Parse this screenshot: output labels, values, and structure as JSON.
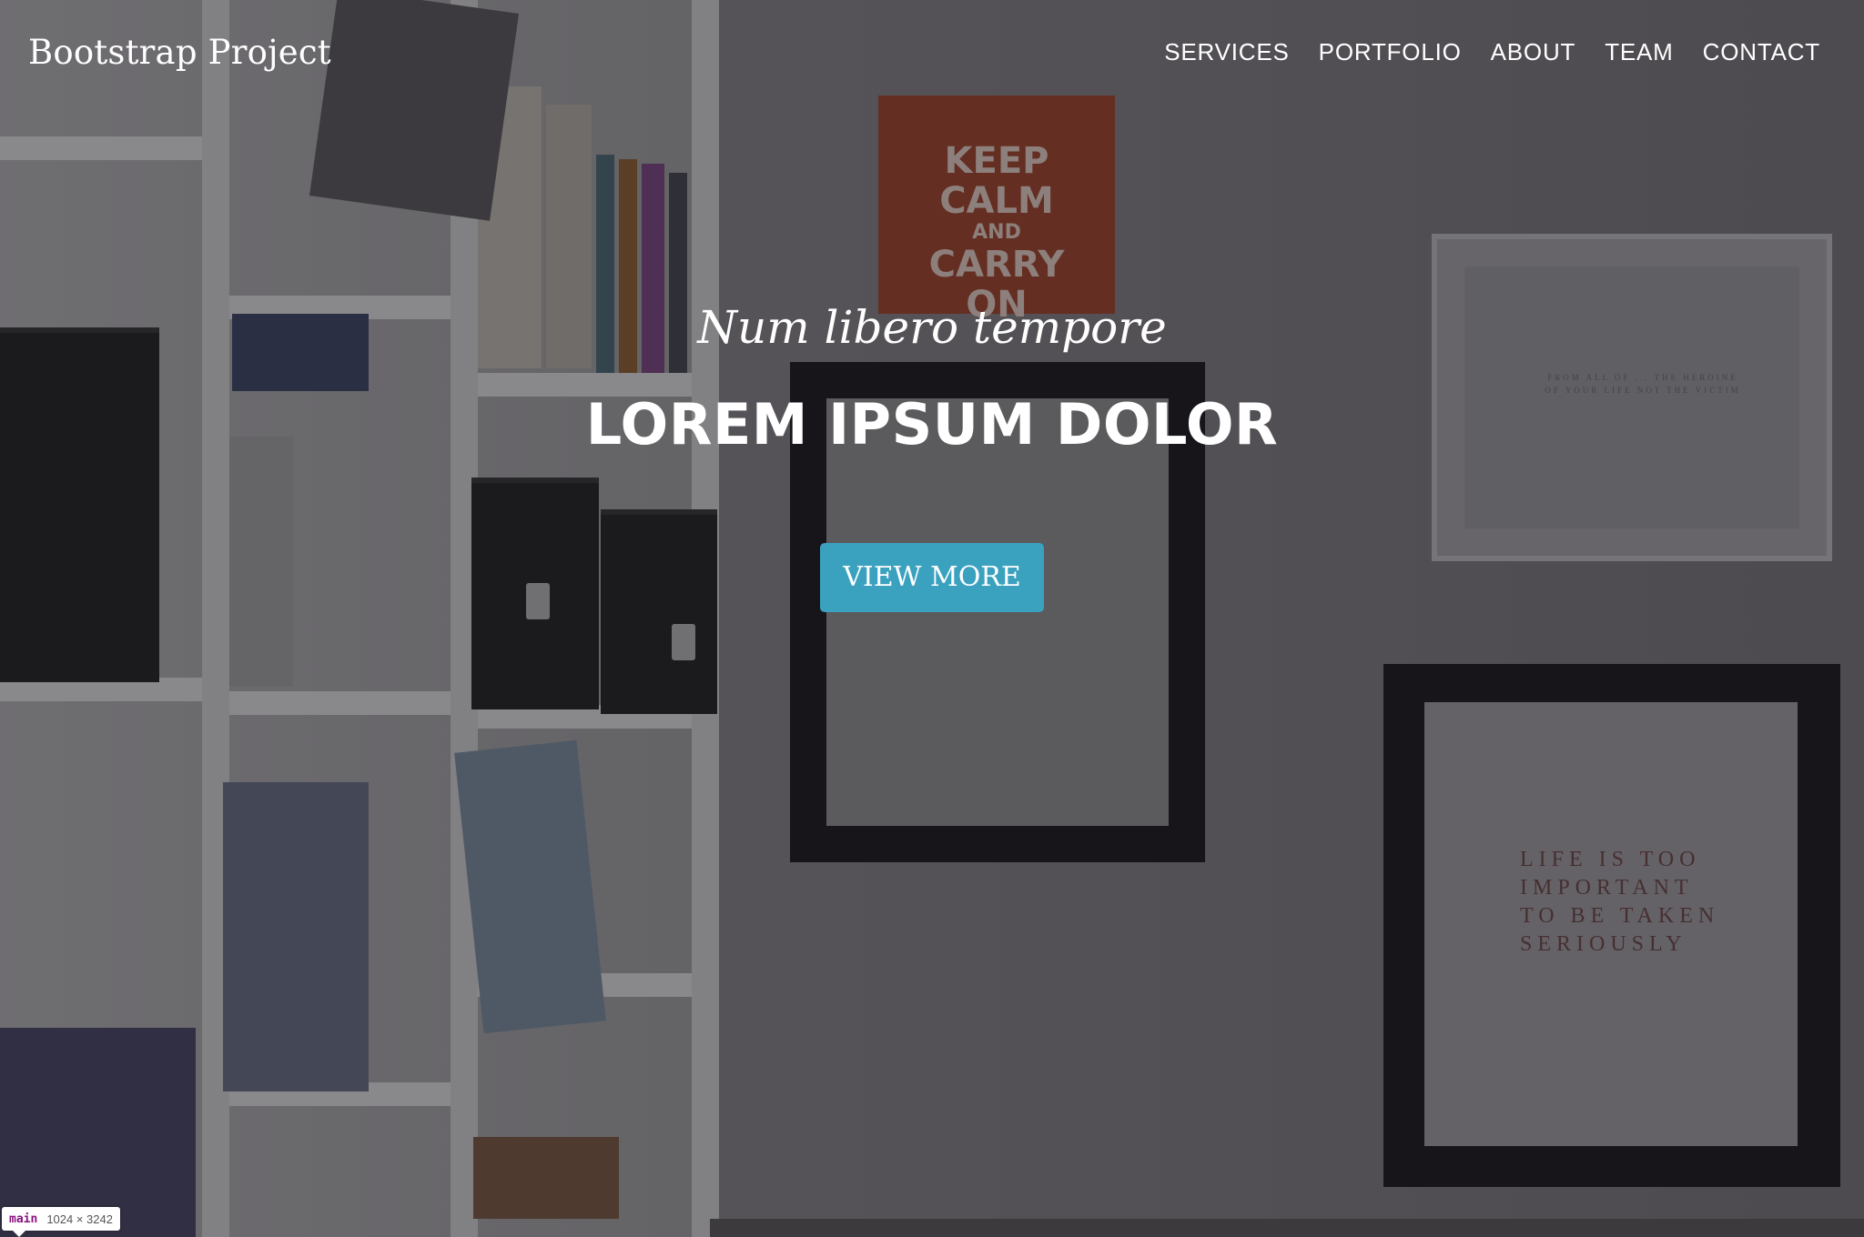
{
  "navbar": {
    "brand": "Bootstrap Project",
    "links": [
      "SERVICES",
      "PORTFOLIO",
      "ABOUT",
      "TEAM",
      "CONTACT"
    ]
  },
  "hero": {
    "subheading": "Num libero tempore",
    "heading": "LOREM IPSUM DOLOR",
    "button_label": "VIEW MORE"
  },
  "background_art": {
    "poster_line1": "KEEP",
    "poster_line2": "CALM",
    "poster_line3": "AND",
    "poster_line4": "CARRY",
    "poster_line5": "ON",
    "print_line1": "LIFE IS TOO",
    "print_line2": "IMPORTANT",
    "print_line3": "TO BE TAKEN",
    "print_line4": "SERIOUSLY"
  },
  "devtools_tooltip": {
    "tag": "main",
    "size": "1024 × 3242"
  },
  "colors": {
    "button": "#3aa1bf",
    "text": "#ffffff",
    "poster": "#8b3a22"
  }
}
